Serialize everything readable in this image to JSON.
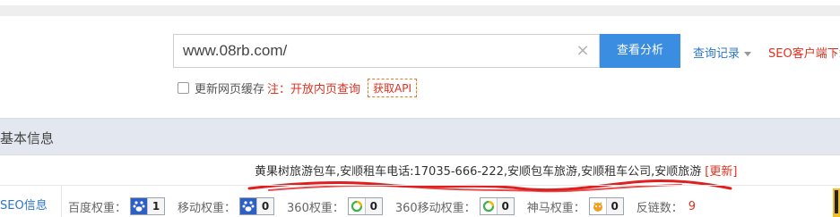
{
  "search": {
    "value": "www.08rb.com/",
    "clear_icon": "×",
    "analyze_label": "查看分析",
    "history_label": "查询记录",
    "seo_client_label": "SEO客户端下载"
  },
  "cache_row": {
    "checkbox_label": "更新网页缓存",
    "note": "注：开放内页查询",
    "api_label": "获取API"
  },
  "section": {
    "title": "基本信息"
  },
  "keywords": {
    "text": "黄果树旅游包车,安顺租车电话:17035-666-222,安顺包车旅游,安顺租车公司,安顺旅游",
    "update_label": "[更新]"
  },
  "seo_info": {
    "label": "SEO信息",
    "metrics": [
      {
        "label": "百度权重：",
        "icon": "baidu-paw-icon",
        "value": "1"
      },
      {
        "label": "移动权重：",
        "icon": "baidu-paw-icon",
        "value": "0"
      },
      {
        "label": "360权重：",
        "icon": "360-ring-icon",
        "value": "0"
      },
      {
        "label": "360移动权重：",
        "icon": "360-ring-icon",
        "value": "0"
      },
      {
        "label": "神马权重：",
        "icon": "shenma-icon",
        "value": "0"
      }
    ],
    "backlinks_label": "反链数：",
    "backlinks_value": "9"
  },
  "colors": {
    "accent_blue": "#3a8de0",
    "link_blue": "#2c75c9",
    "alert_red": "#e0301e",
    "section_bg": "#e3e8f0"
  }
}
